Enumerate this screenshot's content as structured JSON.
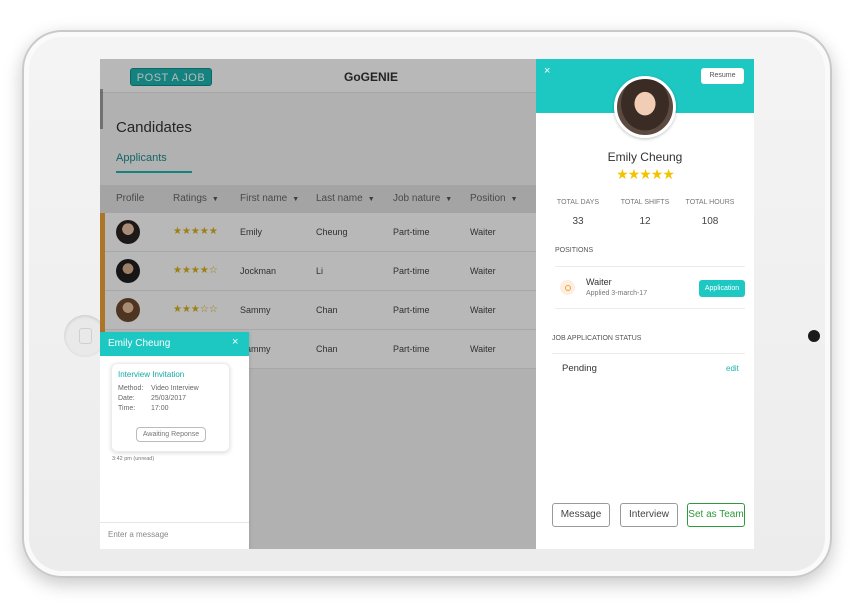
{
  "header": {
    "post_job_label": "POST A JOB",
    "brand": "GoGENIE"
  },
  "page": {
    "title": "Candidates",
    "tab": "Applicants"
  },
  "table": {
    "columns": [
      "Profile",
      "Ratings",
      "First name",
      "Last name",
      "Job nature",
      "Position"
    ],
    "rows": [
      {
        "rating": 5,
        "stars": "★★★★★",
        "first": "Emily",
        "last": "Cheung",
        "nature": "Part-time",
        "position": "Waiter"
      },
      {
        "rating": 4,
        "stars": "★★★★☆",
        "first": "Jockman",
        "last": "Li",
        "nature": "Part-time",
        "position": "Waiter"
      },
      {
        "rating": 3,
        "stars": "★★★☆☆",
        "first": "Sammy",
        "last": "Chan",
        "nature": "Part-time",
        "position": "Waiter"
      },
      {
        "rating": null,
        "stars": "",
        "first": "Sammy",
        "last": "Chan",
        "nature": "Part-time",
        "position": "Waiter"
      }
    ]
  },
  "chat": {
    "name": "Emily Cheung",
    "close": "×",
    "card_title": "Interview Invitation",
    "method_label": "Method:",
    "method_value": "Video Interview",
    "date_label": "Date:",
    "date_value": "25/03/2017",
    "time_label": "Time:",
    "time_value": "17:00",
    "status_button": "Awaiting Reponse",
    "timestamp": "3:42 pm (unread)",
    "input_placeholder": "Enter a message"
  },
  "detail": {
    "close": "×",
    "resume_label": "Resume",
    "name": "Emily Cheung",
    "rating": 5,
    "stars": "★★★★★",
    "stats": [
      {
        "label": "TOTAL DAYS",
        "value": "33"
      },
      {
        "label": "TOTAL SHIFTS",
        "value": "12"
      },
      {
        "label": "TOTAL HOURS",
        "value": "108"
      }
    ],
    "positions_label": "POSITIONS",
    "position": {
      "title": "Waiter",
      "applied": "Applied 3-march-17",
      "button": "Application"
    },
    "status_label": "JOB APPLICATION STATUS",
    "status_value": "Pending",
    "edit_label": "edit",
    "actions": {
      "message": "Message",
      "interview": "Interview",
      "team": "Set as Team"
    }
  },
  "colors": {
    "accent": "#1dc8c3",
    "row_marker": "#f0a23a",
    "star": "#f2c400",
    "team_button": "#2e9a3c"
  }
}
